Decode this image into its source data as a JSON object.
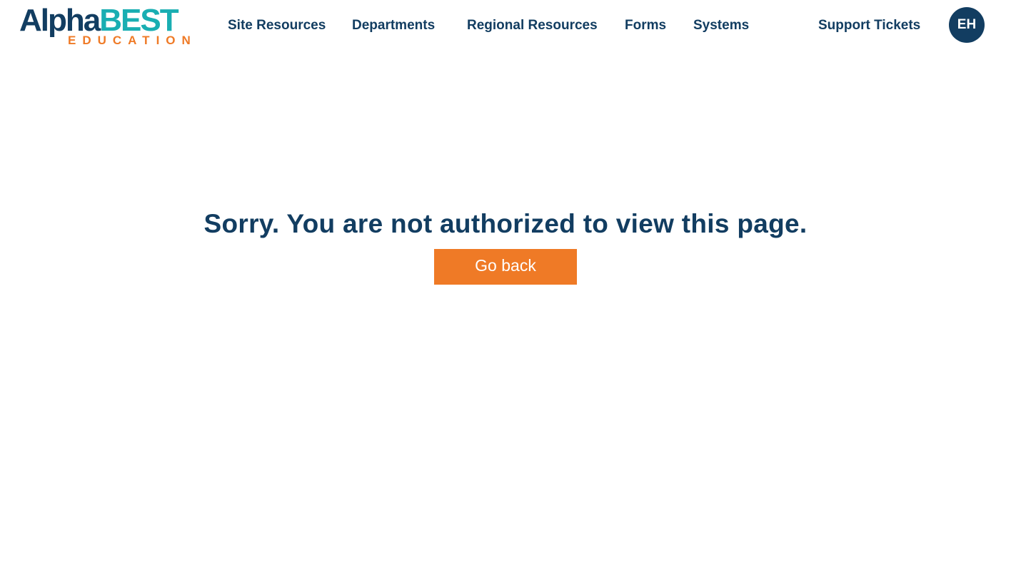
{
  "logo": {
    "alpha": "Alpha",
    "best": "BEST",
    "education": "EDUCATION",
    "colors": {
      "navy": "#123d61",
      "teal": "#19aeb2",
      "orange": "#ef7a26"
    }
  },
  "nav": {
    "items": [
      {
        "label": "Site Resources"
      },
      {
        "label": "Departments"
      },
      {
        "label": "Regional Resources"
      },
      {
        "label": "Forms"
      },
      {
        "label": "Systems"
      }
    ],
    "support": "Support Tickets",
    "avatar_initials": "EH"
  },
  "main": {
    "message": "Sorry. You are not authorized to view this page.",
    "button_label": "Go back"
  },
  "colors": {
    "text_primary": "#123d61",
    "accent": "#ef7a26",
    "avatar_bg": "#123d61",
    "background": "#ffffff"
  }
}
